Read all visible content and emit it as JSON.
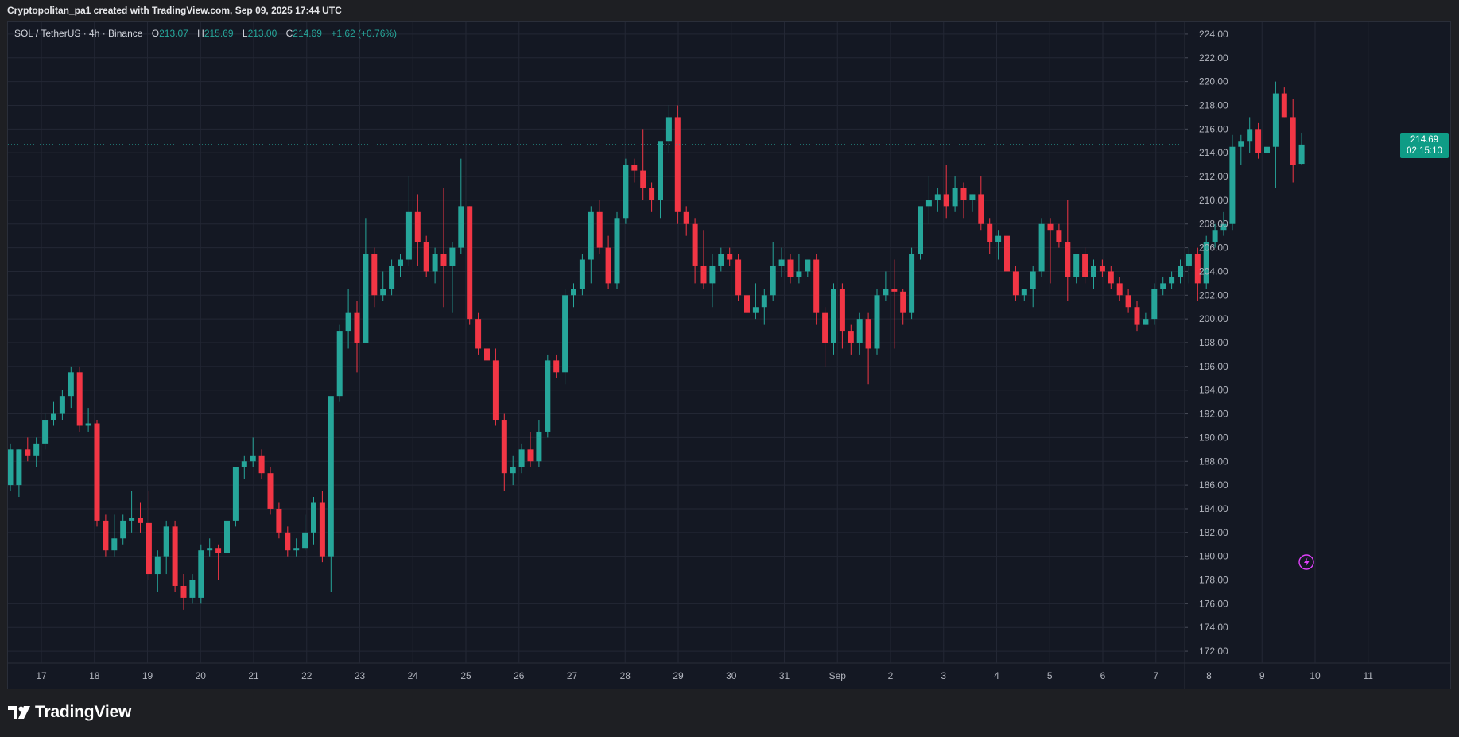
{
  "caption": "Cryptopolitan_pa1 created with TradingView.com, Sep 09, 2025 17:44 UTC",
  "legend": {
    "symbol": "SOL / TetherUS · 4h · Binance",
    "o_label": "O",
    "o_value": "213.07",
    "h_label": "H",
    "h_value": "215.69",
    "l_label": "L",
    "l_value": "213.00",
    "c_label": "C",
    "c_value": "214.69",
    "change": "+1.62 (+0.76%)"
  },
  "price_badge": {
    "price": "214.69",
    "countdown": "02:15:10"
  },
  "brand": "TradingView",
  "icons": {
    "flash": "lightning-icon",
    "logo": "tradingview-logo-icon"
  },
  "colors": {
    "up": "#26a69a",
    "down": "#f23645",
    "background": "#141823",
    "grid": "#232734",
    "badge": "#0f9c86"
  },
  "chart_data": {
    "type": "candlestick",
    "symbol": "SOL / TetherUS",
    "interval": "4h",
    "exchange": "Binance",
    "ylim": [
      171,
      225
    ],
    "y_ticks": [
      "172.00",
      "174.00",
      "176.00",
      "178.00",
      "180.00",
      "182.00",
      "184.00",
      "186.00",
      "188.00",
      "190.00",
      "192.00",
      "194.00",
      "196.00",
      "198.00",
      "200.00",
      "202.00",
      "204.00",
      "206.00",
      "208.00",
      "210.00",
      "212.00",
      "214.00",
      "216.00",
      "218.00",
      "220.00",
      "222.00",
      "224.00"
    ],
    "x_ticks": [
      "17",
      "18",
      "19",
      "20",
      "21",
      "22",
      "23",
      "24",
      "25",
      "26",
      "27",
      "28",
      "29",
      "30",
      "31",
      "Sep",
      "2",
      "3",
      "4",
      "5",
      "6",
      "7",
      "8",
      "9",
      "10",
      "11"
    ],
    "current_price": 214.69,
    "grid": true,
    "candles": [
      {
        "o": 186.0,
        "h": 189.5,
        "l": 185.5,
        "c": 189.0
      },
      {
        "o": 186.0,
        "h": 189.0,
        "l": 185.0,
        "c": 189.0
      },
      {
        "o": 189.0,
        "h": 190.0,
        "l": 188.0,
        "c": 188.5
      },
      {
        "o": 188.5,
        "h": 190.0,
        "l": 187.5,
        "c": 189.5
      },
      {
        "o": 189.5,
        "h": 192.0,
        "l": 189.0,
        "c": 191.5
      },
      {
        "o": 191.5,
        "h": 193.0,
        "l": 191.0,
        "c": 192.0
      },
      {
        "o": 192.0,
        "h": 194.0,
        "l": 191.5,
        "c": 193.5
      },
      {
        "o": 193.5,
        "h": 196.0,
        "l": 192.5,
        "c": 195.5
      },
      {
        "o": 195.5,
        "h": 196.0,
        "l": 190.5,
        "c": 191.0
      },
      {
        "o": 191.0,
        "h": 192.5,
        "l": 190.5,
        "c": 191.2
      },
      {
        "o": 191.2,
        "h": 191.5,
        "l": 182.5,
        "c": 183.0
      },
      {
        "o": 183.0,
        "h": 183.5,
        "l": 180.0,
        "c": 180.5
      },
      {
        "o": 180.5,
        "h": 183.5,
        "l": 180.0,
        "c": 181.5
      },
      {
        "o": 181.5,
        "h": 183.5,
        "l": 181.0,
        "c": 183.0
      },
      {
        "o": 183.0,
        "h": 185.5,
        "l": 182.0,
        "c": 183.2
      },
      {
        "o": 183.2,
        "h": 184.5,
        "l": 182.0,
        "c": 182.8
      },
      {
        "o": 182.8,
        "h": 185.5,
        "l": 178.0,
        "c": 178.5
      },
      {
        "o": 178.5,
        "h": 180.5,
        "l": 177.0,
        "c": 180.0
      },
      {
        "o": 180.0,
        "h": 183.0,
        "l": 178.5,
        "c": 182.5
      },
      {
        "o": 182.5,
        "h": 183.0,
        "l": 177.0,
        "c": 177.5
      },
      {
        "o": 177.5,
        "h": 178.5,
        "l": 175.5,
        "c": 176.5
      },
      {
        "o": 176.5,
        "h": 178.5,
        "l": 176.0,
        "c": 178.0
      },
      {
        "o": 176.5,
        "h": 181.0,
        "l": 176.0,
        "c": 180.5
      },
      {
        "o": 180.5,
        "h": 181.5,
        "l": 180.0,
        "c": 180.7
      },
      {
        "o": 180.7,
        "h": 181.0,
        "l": 178.0,
        "c": 180.3
      },
      {
        "o": 180.3,
        "h": 183.5,
        "l": 177.5,
        "c": 183.0
      },
      {
        "o": 183.0,
        "h": 185.5,
        "l": 182.5,
        "c": 187.5
      },
      {
        "o": 187.5,
        "h": 188.5,
        "l": 186.5,
        "c": 188.0
      },
      {
        "o": 188.0,
        "h": 190.0,
        "l": 187.5,
        "c": 188.5
      },
      {
        "o": 188.5,
        "h": 189.0,
        "l": 186.5,
        "c": 187.0
      },
      {
        "o": 187.0,
        "h": 187.5,
        "l": 183.5,
        "c": 184.0
      },
      {
        "o": 184.0,
        "h": 184.5,
        "l": 181.5,
        "c": 182.0
      },
      {
        "o": 182.0,
        "h": 182.5,
        "l": 180.0,
        "c": 180.5
      },
      {
        "o": 180.5,
        "h": 181.5,
        "l": 180.0,
        "c": 180.7
      },
      {
        "o": 180.7,
        "h": 183.5,
        "l": 180.5,
        "c": 182.0
      },
      {
        "o": 182.0,
        "h": 185.0,
        "l": 181.0,
        "c": 184.5
      },
      {
        "o": 184.5,
        "h": 185.5,
        "l": 179.5,
        "c": 180.0
      },
      {
        "o": 180.0,
        "h": 182.0,
        "l": 177.0,
        "c": 193.5
      },
      {
        "o": 193.5,
        "h": 199.5,
        "l": 193.0,
        "c": 199.0
      },
      {
        "o": 199.0,
        "h": 202.5,
        "l": 197.5,
        "c": 200.5
      },
      {
        "o": 200.5,
        "h": 201.5,
        "l": 195.5,
        "c": 198.0
      },
      {
        "o": 198.0,
        "h": 208.5,
        "l": 198.0,
        "c": 205.5
      },
      {
        "o": 205.5,
        "h": 206.0,
        "l": 201.0,
        "c": 202.0
      },
      {
        "o": 202.0,
        "h": 204.0,
        "l": 201.5,
        "c": 202.5
      },
      {
        "o": 202.5,
        "h": 205.0,
        "l": 202.0,
        "c": 204.5
      },
      {
        "o": 204.5,
        "h": 205.5,
        "l": 203.5,
        "c": 205.0
      },
      {
        "o": 205.0,
        "h": 212.0,
        "l": 204.5,
        "c": 209.0
      },
      {
        "o": 209.0,
        "h": 210.5,
        "l": 204.5,
        "c": 206.5
      },
      {
        "o": 206.5,
        "h": 207.0,
        "l": 203.5,
        "c": 204.0
      },
      {
        "o": 204.0,
        "h": 206.0,
        "l": 203.0,
        "c": 205.5
      },
      {
        "o": 205.5,
        "h": 211.0,
        "l": 201.0,
        "c": 204.5
      },
      {
        "o": 204.5,
        "h": 206.5,
        "l": 200.5,
        "c": 206.0
      },
      {
        "o": 206.0,
        "h": 213.5,
        "l": 205.5,
        "c": 209.5
      },
      {
        "o": 209.5,
        "h": 209.5,
        "l": 199.5,
        "c": 200.0
      },
      {
        "o": 200.0,
        "h": 200.5,
        "l": 197.0,
        "c": 197.5
      },
      {
        "o": 197.5,
        "h": 198.5,
        "l": 195.0,
        "c": 196.5
      },
      {
        "o": 196.5,
        "h": 197.5,
        "l": 191.0,
        "c": 191.5
      },
      {
        "o": 191.5,
        "h": 192.0,
        "l": 185.5,
        "c": 187.0
      },
      {
        "o": 187.0,
        "h": 188.5,
        "l": 186.0,
        "c": 187.5
      },
      {
        "o": 187.5,
        "h": 189.5,
        "l": 187.0,
        "c": 189.0
      },
      {
        "o": 189.0,
        "h": 190.5,
        "l": 187.5,
        "c": 188.0
      },
      {
        "o": 188.0,
        "h": 191.5,
        "l": 187.5,
        "c": 190.5
      },
      {
        "o": 190.5,
        "h": 197.0,
        "l": 190.0,
        "c": 196.5
      },
      {
        "o": 196.5,
        "h": 197.0,
        "l": 195.0,
        "c": 195.5
      },
      {
        "o": 195.5,
        "h": 202.5,
        "l": 194.5,
        "c": 202.0
      },
      {
        "o": 202.0,
        "h": 203.0,
        "l": 201.0,
        "c": 202.5
      },
      {
        "o": 202.5,
        "h": 205.5,
        "l": 202.0,
        "c": 205.0
      },
      {
        "o": 205.0,
        "h": 209.5,
        "l": 203.0,
        "c": 209.0
      },
      {
        "o": 209.0,
        "h": 210.0,
        "l": 205.5,
        "c": 206.0
      },
      {
        "o": 206.0,
        "h": 207.0,
        "l": 202.5,
        "c": 203.0
      },
      {
        "o": 203.0,
        "h": 209.0,
        "l": 202.5,
        "c": 208.5
      },
      {
        "o": 208.5,
        "h": 213.5,
        "l": 208.0,
        "c": 213.0
      },
      {
        "o": 213.0,
        "h": 213.5,
        "l": 211.5,
        "c": 212.5
      },
      {
        "o": 212.5,
        "h": 216.0,
        "l": 210.0,
        "c": 211.0
      },
      {
        "o": 211.0,
        "h": 211.5,
        "l": 209.0,
        "c": 210.0
      },
      {
        "o": 210.0,
        "h": 213.0,
        "l": 208.5,
        "c": 215.0
      },
      {
        "o": 215.0,
        "h": 218.0,
        "l": 214.0,
        "c": 217.0
      },
      {
        "o": 217.0,
        "h": 218.0,
        "l": 208.0,
        "c": 209.0
      },
      {
        "o": 209.0,
        "h": 209.5,
        "l": 207.0,
        "c": 208.0
      },
      {
        "o": 208.0,
        "h": 208.5,
        "l": 203.0,
        "c": 204.5
      },
      {
        "o": 204.5,
        "h": 207.5,
        "l": 202.5,
        "c": 203.0
      },
      {
        "o": 203.0,
        "h": 205.5,
        "l": 201.0,
        "c": 204.5
      },
      {
        "o": 204.5,
        "h": 206.0,
        "l": 204.0,
        "c": 205.5
      },
      {
        "o": 205.5,
        "h": 206.0,
        "l": 204.5,
        "c": 205.0
      },
      {
        "o": 205.0,
        "h": 205.5,
        "l": 201.5,
        "c": 202.0
      },
      {
        "o": 202.0,
        "h": 202.5,
        "l": 197.5,
        "c": 200.5
      },
      {
        "o": 200.5,
        "h": 203.0,
        "l": 200.0,
        "c": 201.0
      },
      {
        "o": 201.0,
        "h": 202.5,
        "l": 199.5,
        "c": 202.0
      },
      {
        "o": 202.0,
        "h": 206.5,
        "l": 201.5,
        "c": 204.5
      },
      {
        "o": 204.5,
        "h": 206.0,
        "l": 203.5,
        "c": 205.0
      },
      {
        "o": 205.0,
        "h": 205.5,
        "l": 203.0,
        "c": 203.5
      },
      {
        "o": 203.5,
        "h": 205.5,
        "l": 203.0,
        "c": 204.0
      },
      {
        "o": 204.0,
        "h": 205.0,
        "l": 203.5,
        "c": 205.0
      },
      {
        "o": 205.0,
        "h": 205.5,
        "l": 199.5,
        "c": 200.5
      },
      {
        "o": 200.5,
        "h": 201.0,
        "l": 196.0,
        "c": 198.0
      },
      {
        "o": 198.0,
        "h": 203.0,
        "l": 197.0,
        "c": 202.5
      },
      {
        "o": 202.5,
        "h": 203.0,
        "l": 197.5,
        "c": 199.0
      },
      {
        "o": 199.0,
        "h": 199.5,
        "l": 197.0,
        "c": 198.0
      },
      {
        "o": 198.0,
        "h": 200.5,
        "l": 197.0,
        "c": 200.0
      },
      {
        "o": 200.0,
        "h": 200.5,
        "l": 194.5,
        "c": 197.5
      },
      {
        "o": 197.5,
        "h": 202.5,
        "l": 197.0,
        "c": 202.0
      },
      {
        "o": 202.0,
        "h": 204.0,
        "l": 201.5,
        "c": 202.5
      },
      {
        "o": 202.5,
        "h": 205.0,
        "l": 197.5,
        "c": 202.3
      },
      {
        "o": 202.3,
        "h": 202.5,
        "l": 199.5,
        "c": 200.5
      },
      {
        "o": 200.5,
        "h": 206.0,
        "l": 200.0,
        "c": 205.5
      },
      {
        "o": 205.5,
        "h": 208.5,
        "l": 205.0,
        "c": 209.5
      },
      {
        "o": 209.5,
        "h": 212.0,
        "l": 208.0,
        "c": 210.0
      },
      {
        "o": 210.0,
        "h": 211.0,
        "l": 209.0,
        "c": 210.5
      },
      {
        "o": 210.5,
        "h": 213.0,
        "l": 208.5,
        "c": 209.5
      },
      {
        "o": 209.5,
        "h": 212.0,
        "l": 209.0,
        "c": 211.0
      },
      {
        "o": 211.0,
        "h": 211.5,
        "l": 208.5,
        "c": 210.0
      },
      {
        "o": 210.0,
        "h": 210.5,
        "l": 209.0,
        "c": 210.5
      },
      {
        "o": 210.5,
        "h": 212.0,
        "l": 207.5,
        "c": 208.0
      },
      {
        "o": 208.0,
        "h": 208.5,
        "l": 205.5,
        "c": 206.5
      },
      {
        "o": 206.5,
        "h": 207.5,
        "l": 205.0,
        "c": 207.0
      },
      {
        "o": 207.0,
        "h": 208.5,
        "l": 203.5,
        "c": 204.0
      },
      {
        "o": 204.0,
        "h": 204.5,
        "l": 201.5,
        "c": 202.0
      },
      {
        "o": 202.0,
        "h": 202.5,
        "l": 201.5,
        "c": 202.5
      },
      {
        "o": 202.5,
        "h": 204.5,
        "l": 201.0,
        "c": 204.0
      },
      {
        "o": 204.0,
        "h": 208.5,
        "l": 203.5,
        "c": 208.0
      },
      {
        "o": 208.0,
        "h": 208.5,
        "l": 203.0,
        "c": 207.5
      },
      {
        "o": 207.5,
        "h": 208.0,
        "l": 206.0,
        "c": 206.5
      },
      {
        "o": 206.5,
        "h": 210.0,
        "l": 201.5,
        "c": 203.5
      },
      {
        "o": 203.5,
        "h": 205.5,
        "l": 203.0,
        "c": 205.5
      },
      {
        "o": 205.5,
        "h": 206.0,
        "l": 203.0,
        "c": 203.5
      },
      {
        "o": 203.5,
        "h": 205.0,
        "l": 202.5,
        "c": 204.5
      },
      {
        "o": 204.5,
        "h": 205.0,
        "l": 203.5,
        "c": 204.0
      },
      {
        "o": 204.0,
        "h": 204.5,
        "l": 202.5,
        "c": 203.0
      },
      {
        "o": 203.0,
        "h": 203.5,
        "l": 201.5,
        "c": 202.0
      },
      {
        "o": 202.0,
        "h": 202.5,
        "l": 200.5,
        "c": 201.0
      },
      {
        "o": 201.0,
        "h": 201.5,
        "l": 199.0,
        "c": 199.5
      },
      {
        "o": 199.5,
        "h": 200.5,
        "l": 199.5,
        "c": 200.0
      },
      {
        "o": 200.0,
        "h": 203.0,
        "l": 199.5,
        "c": 202.5
      },
      {
        "o": 202.5,
        "h": 203.5,
        "l": 202.0,
        "c": 203.0
      },
      {
        "o": 203.0,
        "h": 204.0,
        "l": 202.5,
        "c": 203.5
      },
      {
        "o": 203.5,
        "h": 205.0,
        "l": 203.0,
        "c": 204.5
      },
      {
        "o": 204.5,
        "h": 206.0,
        "l": 203.0,
        "c": 205.5
      },
      {
        "o": 205.5,
        "h": 206.0,
        "l": 201.5,
        "c": 203.0
      },
      {
        "o": 203.0,
        "h": 207.0,
        "l": 202.5,
        "c": 206.5
      },
      {
        "o": 206.5,
        "h": 208.0,
        "l": 206.0,
        "c": 207.5
      },
      {
        "o": 207.5,
        "h": 209.0,
        "l": 207.0,
        "c": 208.0
      },
      {
        "o": 208.0,
        "h": 215.5,
        "l": 207.5,
        "c": 214.5
      },
      {
        "o": 214.5,
        "h": 215.5,
        "l": 213.0,
        "c": 215.0
      },
      {
        "o": 215.0,
        "h": 217.0,
        "l": 214.0,
        "c": 216.0
      },
      {
        "o": 216.0,
        "h": 216.5,
        "l": 213.5,
        "c": 214.0
      },
      {
        "o": 214.0,
        "h": 215.5,
        "l": 213.5,
        "c": 214.5
      },
      {
        "o": 214.5,
        "h": 220.0,
        "l": 211.0,
        "c": 219.0
      },
      {
        "o": 219.0,
        "h": 219.5,
        "l": 217.0,
        "c": 217.0
      },
      {
        "o": 217.0,
        "h": 218.5,
        "l": 211.5,
        "c": 213.0
      },
      {
        "o": 213.07,
        "h": 215.69,
        "l": 213.0,
        "c": 214.69
      }
    ]
  }
}
